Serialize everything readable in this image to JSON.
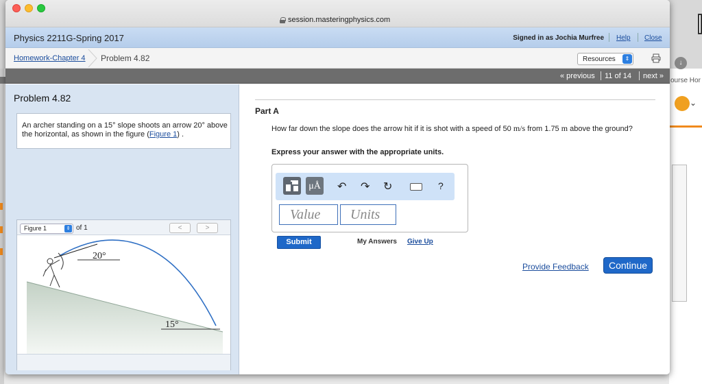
{
  "browser": {
    "url": "session.masteringphysics.com"
  },
  "header": {
    "course_title": "Physics 2211G-Spring 2017",
    "signed_in": "Signed in as Jochia Murfree",
    "help": "Help",
    "close": "Close"
  },
  "breadcrumb": {
    "parent": "Homework-Chapter 4",
    "current": "Problem 4.82",
    "resources": "Resources"
  },
  "nav": {
    "previous": "« previous",
    "count": "11 of 14",
    "next": "next »"
  },
  "problem": {
    "title": "Problem 4.82",
    "text_before": "An archer standing on a 15° slope shoots an arrow 20° above the horizontal, as shown in the figure (",
    "figure_link": "Figure 1",
    "text_after": ") ."
  },
  "figure": {
    "selected": "Figure 1",
    "of_label": "of 1",
    "prev": "<",
    "next": ">",
    "angle_top": "20°",
    "angle_bottom": "15°"
  },
  "part": {
    "label": "Part A",
    "question_a": "How far down the slope does the arrow hit if it is shot with a speed of 50 ",
    "unit_speed": "m/s",
    "question_b": " from 1.75 ",
    "unit_height": "m",
    "question_c": " above the ground?",
    "instruction": "Express your answer with the appropriate units.",
    "toolbar_mu": "μÅ",
    "toolbar_help": "?",
    "value_placeholder": "Value",
    "units_placeholder": "Units",
    "submit": "Submit",
    "my_answers": "My Answers",
    "give_up": "Give Up",
    "feedback": "Provide Feedback",
    "continue": "Continue"
  },
  "background": {
    "right_text": "ourse Hor"
  },
  "colors": {
    "accent": "#1f68c8",
    "header_bg": "#c9dcf3",
    "left_pane_bg": "#d8e4f2",
    "nav_bg": "#6d6d6d"
  }
}
